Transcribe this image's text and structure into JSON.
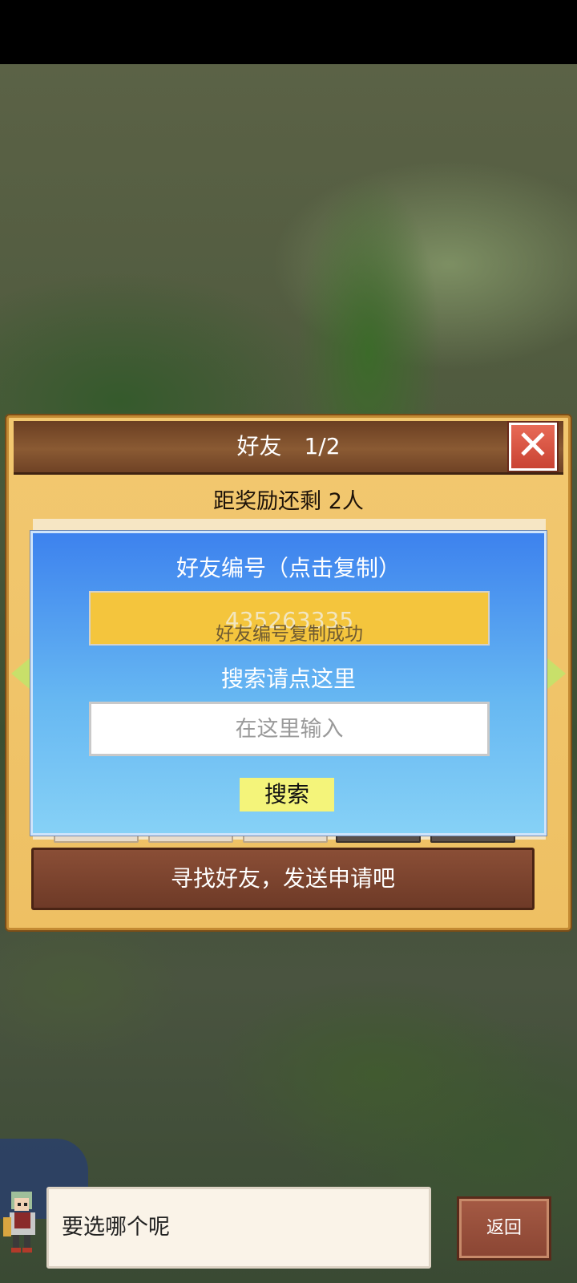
{
  "dialog": {
    "title": "好友　1/2",
    "reward_text": "距奖励还剩 2人",
    "find_friends_button": "寻找好友，发送申请吧"
  },
  "popup": {
    "title": "好友编号（点击复制）",
    "friend_id": "435263335",
    "toast": "好友编号复制成功",
    "search_hint": "搜索请点这里",
    "search_placeholder": "在这里输入",
    "search_button": "搜索"
  },
  "chat": {
    "speech": "要选哪个呢",
    "back_button": "返回"
  }
}
